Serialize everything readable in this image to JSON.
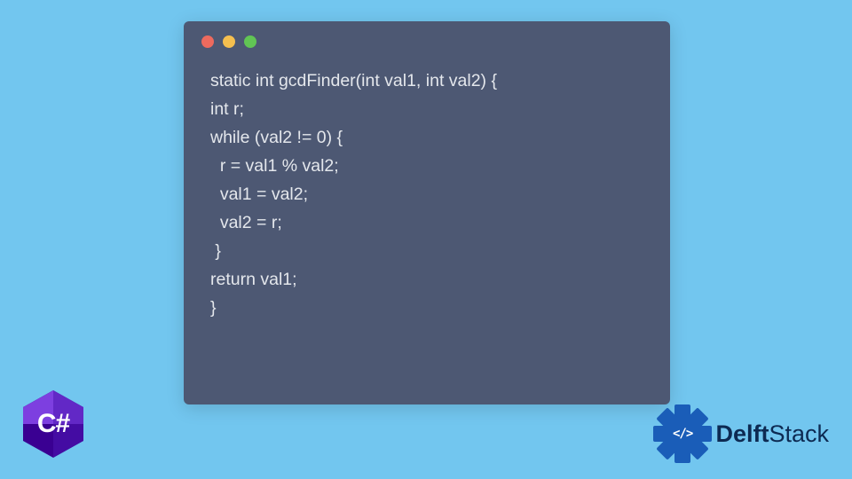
{
  "code": {
    "line1": "static int gcdFinder(int val1, int val2) {",
    "line2": "int r;",
    "line3": "while (val2 != 0) {",
    "line4": "  r = val1 % val2;",
    "line5": "  val1 = val2;",
    "line6": "  val2 = r;",
    "line7": " }",
    "line8": "return val1;",
    "line9": "}"
  },
  "badge": {
    "csharp": "C#"
  },
  "brand": {
    "slash": "</>",
    "name_bold": "Delft",
    "name_rest": "Stack"
  },
  "colors": {
    "background": "#72c6ef",
    "window": "#4d5873",
    "dot_red": "#ed6a5e",
    "dot_yellow": "#f5bf4f",
    "dot_green": "#61c554",
    "code_text": "#e4e7ec",
    "csharp_purple": "#3a0092",
    "brand_blue": "#1a5db8"
  }
}
